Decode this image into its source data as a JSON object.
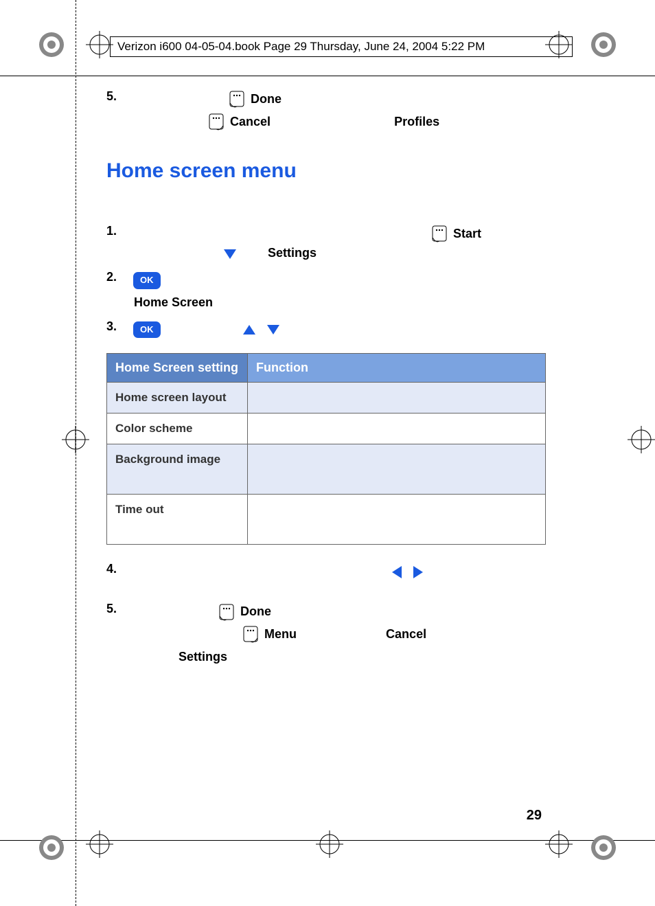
{
  "print_header": "Verizon i600 04-05-04.book  Page 29  Thursday, June 24, 2004  5:22 PM",
  "top_step5": {
    "num": "5.",
    "done": "Done",
    "cancel": "Cancel",
    "profiles": "Profiles"
  },
  "heading": "Home screen menu",
  "steps": {
    "s1": {
      "num": "1.",
      "start": "Start",
      "settings": "Settings"
    },
    "s2": {
      "num": "2.",
      "ok": "OK",
      "home_screen": "Home Screen"
    },
    "s3": {
      "num": "3.",
      "ok": "OK"
    },
    "s4": {
      "num": "4."
    },
    "s5": {
      "num": "5.",
      "done": "Done",
      "menu": "Menu",
      "cancel": "Cancel",
      "settings": "Settings"
    }
  },
  "table": {
    "h1": "Home Screen setting",
    "h2": "Function",
    "rows": [
      {
        "setting": "Home screen layout",
        "func": ""
      },
      {
        "setting": "Color scheme",
        "func": ""
      },
      {
        "setting": "Background image",
        "func": ""
      },
      {
        "setting": "Time out",
        "func": ""
      }
    ]
  },
  "page_num": "29"
}
